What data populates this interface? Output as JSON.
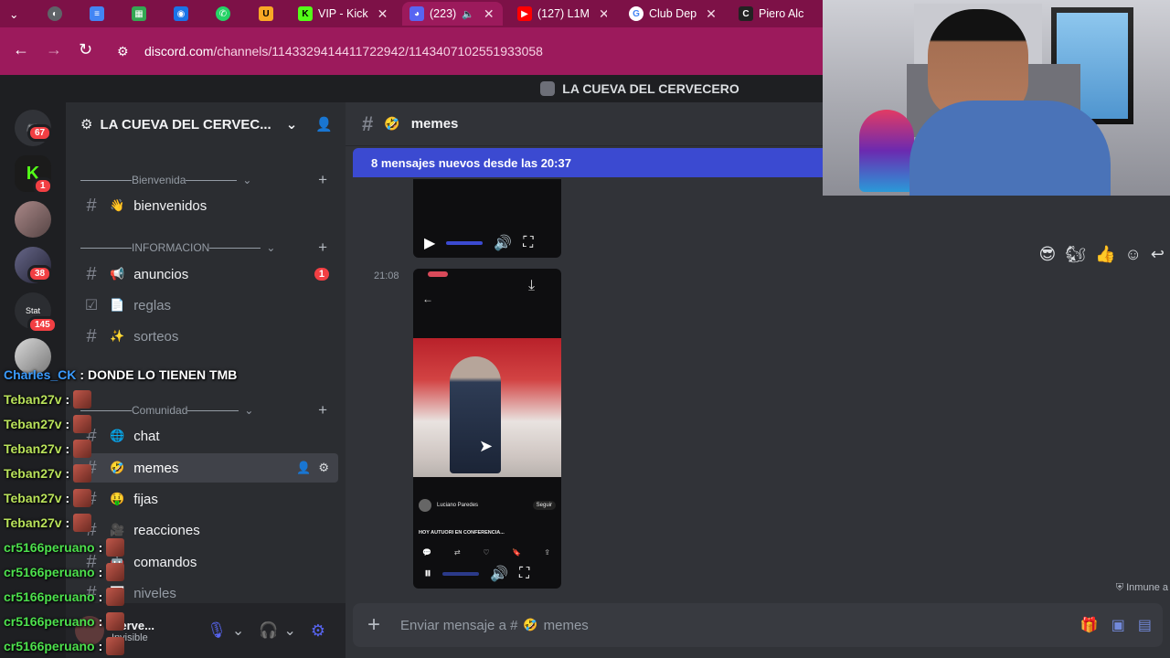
{
  "browser": {
    "tabs": [
      {
        "label": "",
        "icon": "chevron-down-icon"
      },
      {
        "label": "",
        "icon": "globe-icon"
      },
      {
        "label": "",
        "icon": "docs-icon"
      },
      {
        "label": "",
        "icon": "sheets-icon"
      },
      {
        "label": "",
        "icon": "clockify-icon"
      },
      {
        "label": "",
        "icon": "whatsapp-icon"
      },
      {
        "label": "",
        "icon": "u-icon"
      },
      {
        "label": "VIP - Kick",
        "icon": "kick-icon"
      },
      {
        "label": "(223)",
        "icon": "discord-icon",
        "badge": "223"
      },
      {
        "label": "(127) L1M",
        "icon": "youtube-icon"
      },
      {
        "label": "Club Dep",
        "icon": "google-icon"
      },
      {
        "label": "Piero Alc",
        "icon": "site-icon"
      }
    ],
    "url_domain": "discord.com",
    "url_path": "/channels/1143329414411722942/1143407102551933058"
  },
  "server_title": "LA CUEVA DEL CERVECERO",
  "rail": {
    "badges": [
      "67",
      "1",
      "38",
      "145"
    ]
  },
  "sidebar": {
    "guild_name": "LA CUEVA DEL CERVEC...",
    "categories": [
      {
        "label": "Bienvenida"
      },
      {
        "label": "INFORMACION"
      },
      {
        "label": "Comunidad"
      }
    ],
    "channels": [
      {
        "name": "bienvenidos",
        "emoji": "👋"
      },
      {
        "name": "anuncios",
        "emoji": "📢",
        "badge": "1"
      },
      {
        "name": "reglas",
        "emoji": "📄"
      },
      {
        "name": "sorteos",
        "emoji": "✨"
      },
      {
        "name": "chat",
        "emoji": "🌐"
      },
      {
        "name": "memes",
        "emoji": "🤣"
      },
      {
        "name": "fijas",
        "emoji": "🤑"
      },
      {
        "name": "reacciones",
        "emoji": "🎥"
      },
      {
        "name": "comandos",
        "emoji": "🤖"
      },
      {
        "name": "niveles",
        "emoji": "📊"
      }
    ],
    "user_status": "Invisible",
    "user_name": "Cerve..."
  },
  "main": {
    "channel_name": "memes",
    "channel_emoji": "🤣",
    "new_messages_banner": "8 mensajes nuevos desde las 20:37",
    "timestamp": "21:08",
    "video_caption_author": "Luciano Paredes",
    "video_caption_follow": "Seguir",
    "video_caption_text": "HOY AUTUORI EN CONFERENCIA...",
    "immune_label": "Inmune a",
    "composer_placeholder": "Enviar mensaje a #",
    "composer_channel": "memes"
  },
  "chat_overlay": [
    {
      "user": "Charles_CK",
      "text": "DONDE LO TIENEN TMB",
      "color": "#3a9bff"
    },
    {
      "user": "Teban27v",
      "text": "",
      "color": "#b9e25a"
    },
    {
      "user": "Teban27v",
      "text": "",
      "color": "#b9e25a"
    },
    {
      "user": "Teban27v",
      "text": "",
      "color": "#b9e25a"
    },
    {
      "user": "Teban27v",
      "text": "",
      "color": "#b9e25a"
    },
    {
      "user": "Teban27v",
      "text": "",
      "color": "#b9e25a"
    },
    {
      "user": "Teban27v",
      "text": "",
      "color": "#b9e25a"
    },
    {
      "user": "cr5166peruano",
      "text": "",
      "color": "#4de04d"
    },
    {
      "user": "cr5166peruano",
      "text": "",
      "color": "#4de04d"
    },
    {
      "user": "cr5166peruano",
      "text": "",
      "color": "#4de04d"
    },
    {
      "user": "cr5166peruano",
      "text": "",
      "color": "#4de04d"
    },
    {
      "user": "cr5166peruano",
      "text": "",
      "color": "#4de04d"
    }
  ],
  "colors": {
    "browser_bg": "#9c1a5c",
    "banner": "#3b4ad1",
    "badge": "#f23f43"
  }
}
